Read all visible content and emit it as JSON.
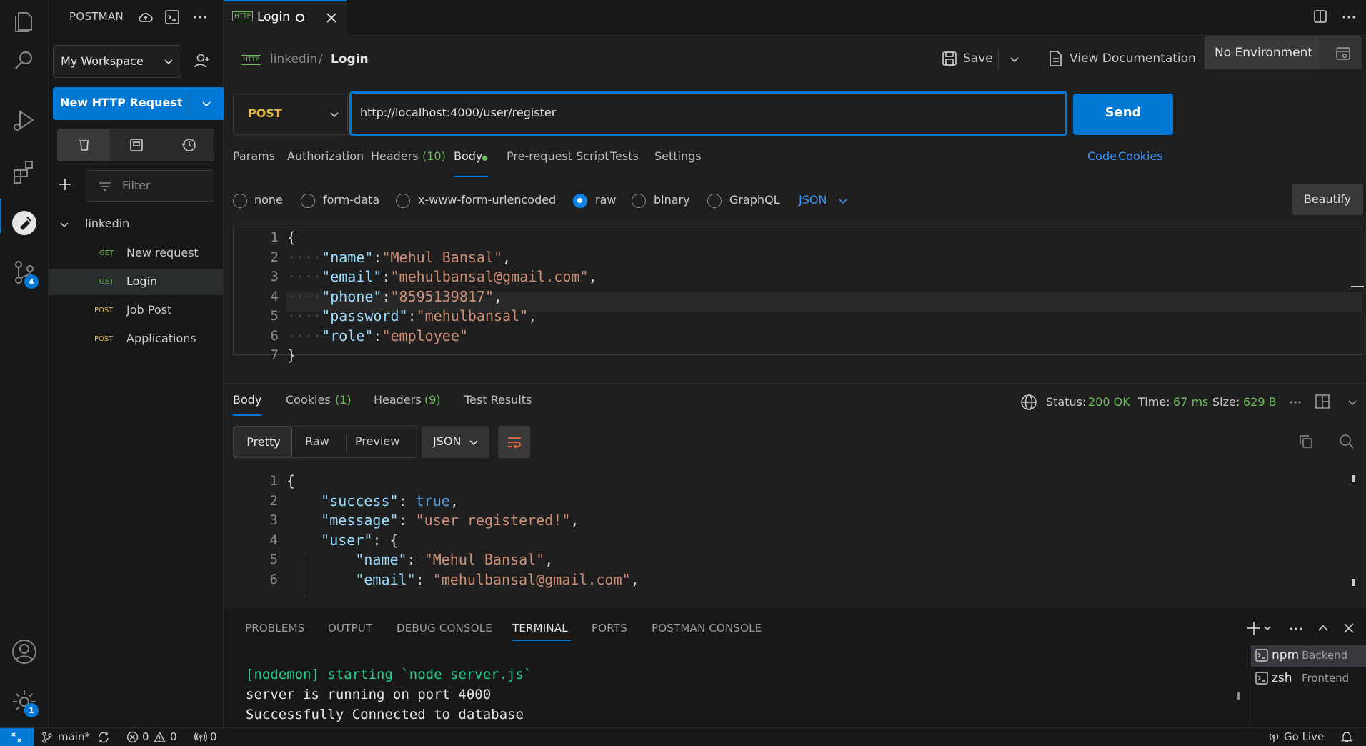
{
  "activity_bar": {
    "source_control_badge": "4",
    "settings_badge": "1"
  },
  "sidebar": {
    "title": "POSTMAN",
    "workspace": "My Workspace",
    "new_request_label": "New HTTP Request",
    "filter_placeholder": "Filter",
    "collection_name": "linkedin",
    "requests": [
      {
        "method": "GET",
        "name": "New request"
      },
      {
        "method": "GET",
        "name": "Login"
      },
      {
        "method": "POST",
        "name": "Job Post"
      },
      {
        "method": "POST",
        "name": "Applications"
      }
    ]
  },
  "tab": {
    "badge": "HTTP",
    "title": "Login"
  },
  "breadcrumb": {
    "badge": "HTTP",
    "collection": "linkedin",
    "separator": "/",
    "request": "Login"
  },
  "toolbar": {
    "save_label": "Save",
    "view_docs_label": "View Documentation",
    "environment": "No Environment"
  },
  "request": {
    "method": "POST",
    "url": "http://localhost:4000/user/register",
    "send_label": "Send",
    "tabs": {
      "params": "Params",
      "authorization": "Authorization",
      "headers": "Headers",
      "headers_count": "(10)",
      "body": "Body",
      "pre_request": "Pre-request Script",
      "tests": "Tests",
      "settings": "Settings"
    },
    "code_link": "Code",
    "cookies_link": "Cookies",
    "body_types": {
      "none": "none",
      "form_data": "form-data",
      "urlencoded": "x-www-form-urlencoded",
      "raw": "raw",
      "binary": "binary",
      "graphql": "GraphQL"
    },
    "raw_format": "JSON",
    "beautify_label": "Beautify",
    "body_lines": {
      "open": "{",
      "close": "}",
      "name_key": "\"name\"",
      "name_val": "\"Mehul Bansal\"",
      "email_key": "\"email\"",
      "email_val": "\"mehulbansal@gmail.com\"",
      "phone_key": "\"phone\"",
      "phone_val": "\"8595139817\"",
      "password_key": "\"password\"",
      "password_val": "\"mehulbansal\"",
      "role_key": "\"role\"",
      "role_val": "\"employee\""
    },
    "line_numbers": [
      "1",
      "2",
      "3",
      "4",
      "5",
      "6",
      "7"
    ]
  },
  "response": {
    "tabs": {
      "body": "Body",
      "cookies": "Cookies",
      "cookies_count": "(1)",
      "headers": "Headers",
      "headers_count": "(9)",
      "test_results": "Test Results"
    },
    "status_label": "Status:",
    "status_value": "200 OK",
    "time_label": "Time:",
    "time_value": "67 ms",
    "size_label": "Size:",
    "size_value": "629 B",
    "view_modes": {
      "pretty": "Pretty",
      "raw": "Raw",
      "preview": "Preview"
    },
    "format": "JSON",
    "body_lines": {
      "open": "{",
      "success_key": "\"success\"",
      "success_val": "true",
      "message_key": "\"message\"",
      "message_val": "\"user registered!\"",
      "user_key": "\"user\"",
      "user_open": "{",
      "name_key": "\"name\"",
      "name_val": "\"Mehul Bansal\"",
      "email_key": "\"email\"",
      "email_val": "\"mehulbansal@gmail.com\""
    },
    "line_numbers": [
      "1",
      "2",
      "3",
      "4",
      "5",
      "6"
    ]
  },
  "panel": {
    "tabs": [
      "PROBLEMS",
      "OUTPUT",
      "DEBUG CONSOLE",
      "TERMINAL",
      "PORTS",
      "POSTMAN CONSOLE"
    ],
    "terminal_lines": [
      "[nodemon] starting `node server.js`",
      "server is running on port 4000",
      "Successfully Connected to database"
    ],
    "terminals": [
      {
        "shell": "npm",
        "name": "Backend"
      },
      {
        "shell": "zsh",
        "name": "Frontend"
      }
    ]
  },
  "status_bar": {
    "branch": "main*",
    "errors": "0",
    "warnings": "0",
    "ports": "0",
    "go_live": "Go Live"
  },
  "colors": {
    "accent": "#0078d4",
    "post_method": "#e9b949",
    "get_method": "#6bbf59",
    "status_ok": "#6bbf59"
  }
}
